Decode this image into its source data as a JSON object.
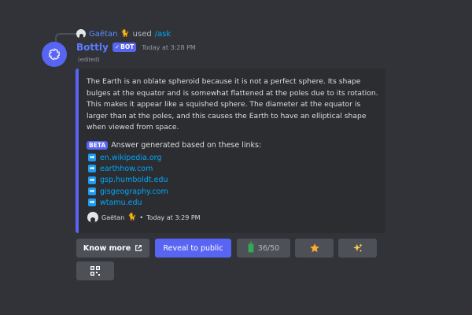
{
  "reply": {
    "user_name": "Gaëtan",
    "user_emoji": "🐈",
    "used_text": "used",
    "command": "/ask"
  },
  "message": {
    "author": "Bottly",
    "badge": "BOT",
    "timestamp": "Today at 3:28 PM",
    "edited": "(edited)"
  },
  "embed": {
    "description": "The Earth is an oblate spheroid because it is not a perfect sphere. Its shape bulges at the equator and is somewhat flattened at the poles due to its rotation. This makes it appear like a squished sphere. The diameter at the equator is larger than at the poles, and this causes the Earth to have an elliptical shape when viewed from space.",
    "beta_badge": "BETA",
    "sources_intro": "Answer generated based on these links:",
    "links": [
      "en.wikipedia.org",
      "earthhow.com",
      "gsp.humboldt.edu",
      "gisgeography.com",
      "wtamu.edu"
    ],
    "footer": {
      "user": "Gaëtan",
      "emoji": "🐈",
      "separator": "•",
      "timestamp": "Today at 3:29 PM"
    }
  },
  "buttons": {
    "know_more": "Know more",
    "reveal": "Reveal to public",
    "count": "36/50",
    "star_icon": "star-icon",
    "sparkle_icon": "sparkles-icon",
    "grid_icon": "qr-grid-icon"
  },
  "colors": {
    "background": "#313338",
    "embed_bg": "#2b2d31",
    "accent": "#5865f2",
    "link": "#00a8fc"
  }
}
